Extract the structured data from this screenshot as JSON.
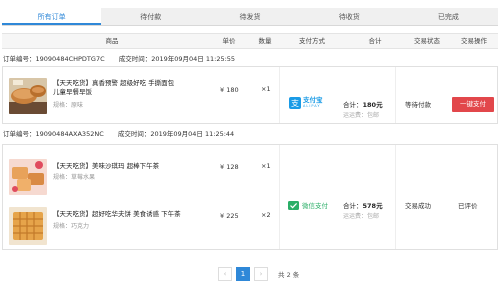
{
  "tabs": [
    {
      "label": "所有订单"
    },
    {
      "label": "待付款"
    },
    {
      "label": "待发货"
    },
    {
      "label": "待收货"
    },
    {
      "label": "已完成"
    }
  ],
  "table_header": {
    "product": "商品",
    "unit_price": "单价",
    "quantity": "数量",
    "payment_method": "支付方式",
    "total": "合计",
    "status": "交易状态",
    "action": "交易操作"
  },
  "orders": [
    {
      "order_no": "订单编号：19090484CHPDTG7C",
      "time": "成交时间：2019年09月04日 11:25:55",
      "items": [
        {
          "title": "【天天吃货】真香预警 超级好吃 手撕面包 儿童早餐早饭",
          "spec": "规格：原味",
          "price": "¥ 180",
          "qty": "×1"
        }
      ],
      "payment_label": "支付宝",
      "payment_sub": "ALIPAY",
      "total_label": "合计：",
      "total_value": "180元",
      "shipping": "运运费：包邮",
      "status": "等待付款",
      "action": "一键支付"
    },
    {
      "order_no": "订单编号：19090484AXA352NC",
      "time": "成交时间：2019年09月04日 11:25:44",
      "items": [
        {
          "title": "【天天吃货】美味沙琪玛 超棒下午茶",
          "spec": "规格：草莓水果",
          "price": "¥ 128",
          "qty": "×1"
        },
        {
          "title": "【天天吃货】超好吃华夫饼 美食诱惑 下午茶",
          "spec": "规格：巧克力",
          "price": "¥ 225",
          "qty": "×2"
        }
      ],
      "payment_label": "微信支付",
      "total_label": "合计：",
      "total_value": "578元",
      "shipping": "运运费：包邮",
      "status": "交易成功",
      "action": "已评价"
    }
  ],
  "pagination": {
    "prev": "‹",
    "current": "1",
    "next": "›",
    "total_text": "共 2 条"
  },
  "colors": {
    "accent": "#2f88d8",
    "pay_button": "#e2474b",
    "alipay": "#1a9be6",
    "wechat": "#2aae67"
  }
}
